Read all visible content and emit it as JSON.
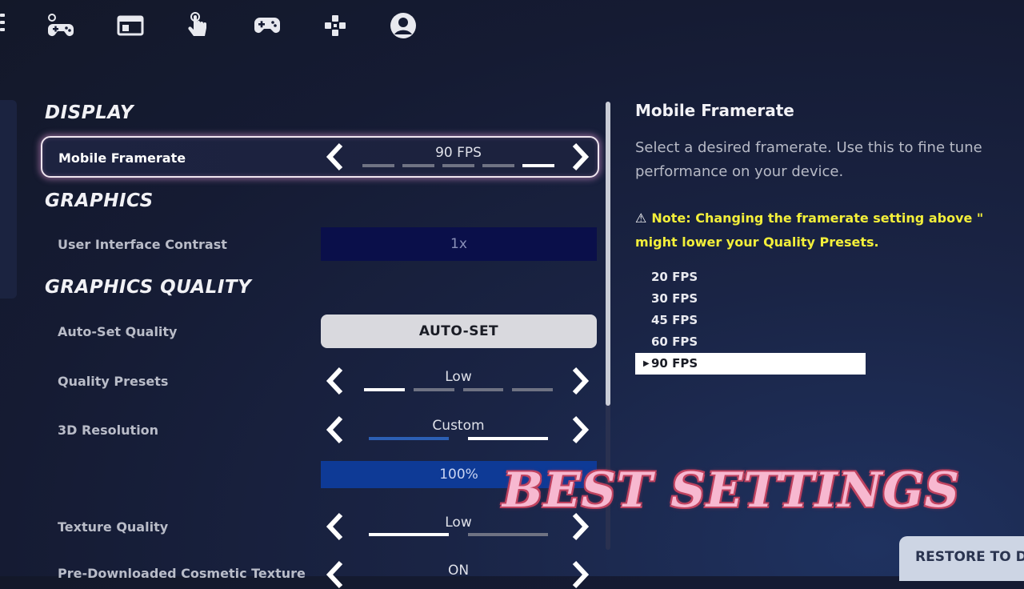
{
  "top_tabs": [
    {
      "icon": "game-settings-icon"
    },
    {
      "icon": "window-icon"
    },
    {
      "icon": "touch-icon"
    },
    {
      "icon": "controller-icon"
    },
    {
      "icon": "dpad-icon"
    },
    {
      "icon": "account-icon"
    }
  ],
  "sections": {
    "display": "DISPLAY",
    "graphics": "GRAPHICS",
    "graphics_quality": "GRAPHICS QUALITY"
  },
  "settings": {
    "mobile_framerate": {
      "label": "Mobile Framerate",
      "value": "90 FPS",
      "level": 5,
      "levels": 5
    },
    "ui_contrast": {
      "label": "User Interface Contrast",
      "value": "1x"
    },
    "auto_set_quality": {
      "label": "Auto-Set Quality",
      "button": "AUTO-SET"
    },
    "quality_presets": {
      "label": "Quality Presets",
      "value": "Low",
      "level": 1,
      "levels": 4
    },
    "resolution_3d": {
      "label": "3D Resolution",
      "value": "Custom",
      "level": 2,
      "levels": 2,
      "percent_value": "100%"
    },
    "texture_quality": {
      "label": "Texture Quality",
      "value": "Low",
      "level": 1,
      "levels": 2
    },
    "cosmetic_texture": {
      "label": "Pre-Downloaded Cosmetic Texture",
      "value": "ON"
    }
  },
  "detail": {
    "title": "Mobile Framerate",
    "description": "Select a desired framerate. Use this to fine tune performance on your device.",
    "note_icon": "⚠",
    "note": "Note: Changing the framerate setting above \"",
    "note_line2": "might lower your Quality Presets.",
    "options": [
      "20 FPS",
      "30 FPS",
      "45 FPS",
      "60 FPS",
      "90 FPS"
    ],
    "selected_option": "90 FPS"
  },
  "overlay_text": "BEST SETTINGS",
  "restore_button": "RESTORE TO D",
  "colors": {
    "background": "#151b33",
    "accent_highlight": "#f0e6f0",
    "note_yellow": "#f3ef3a",
    "contrast_field": "#0a0f4a",
    "percent_field": "#0e3a96",
    "overlay_pink": "#f7b8d0"
  }
}
